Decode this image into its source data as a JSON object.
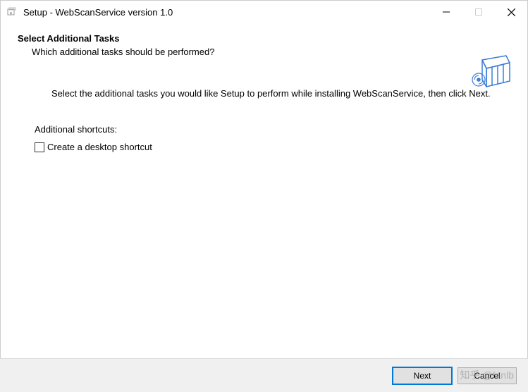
{
  "window": {
    "title": "Setup - WebScanService version 1.0"
  },
  "header": {
    "title": "Select Additional Tasks",
    "subtitle": "Which additional tasks should be performed?"
  },
  "content": {
    "instruction": "Select the additional tasks you would like Setup to perform while installing WebScanService, then click Next.",
    "section_label": "Additional shortcuts:",
    "checkbox_label": "Create a desktop shortcut",
    "checkbox_checked": false
  },
  "footer": {
    "next_label": "Next",
    "cancel_label": "Cancel"
  },
  "watermark": "知乎 @fanlb"
}
